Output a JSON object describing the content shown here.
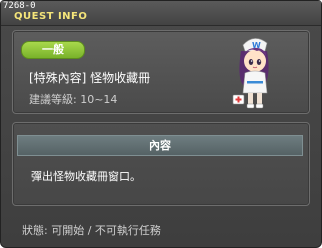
{
  "window": {
    "id": "7268-0",
    "title": "QUEST INFO"
  },
  "quest": {
    "category": "一般",
    "name": "[特殊內容] 怪物收藏冊",
    "level": "建議等級: 10~14"
  },
  "content": {
    "header": "內容",
    "text": "彈出怪物收藏冊窗口。"
  },
  "status": "狀態: 可開始 / 不可執行任務",
  "colors": {
    "title": "#f5e57a",
    "badge": "#8cc63f",
    "background": "#444444"
  }
}
